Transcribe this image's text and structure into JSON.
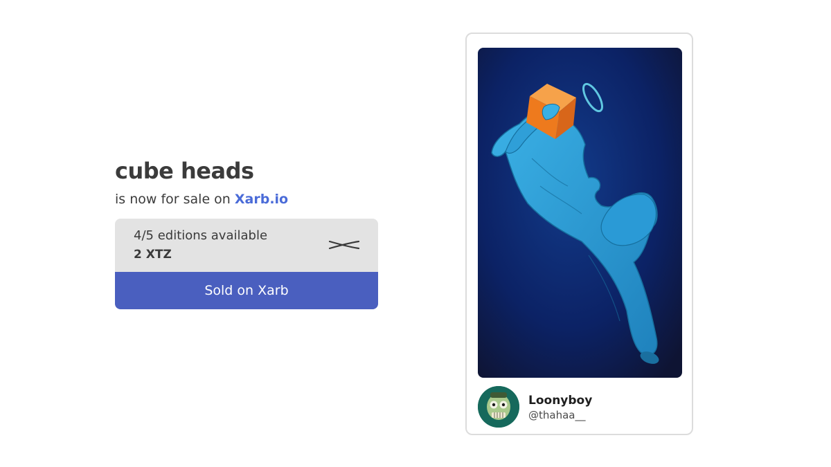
{
  "promo": {
    "title": "cube heads",
    "subtitle_prefix": "is now for sale on ",
    "marketplace": "Xarb.io"
  },
  "listing": {
    "editions": "4/5 editions available",
    "price": "2 XTZ",
    "logo_icon": "xarb-logo-icon",
    "button_label": "Sold on Xarb"
  },
  "card": {
    "artwork_icon": "artwork-image",
    "creator": {
      "name": "Loonyboy",
      "handle": "@thahaa__",
      "avatar_icon": "avatar-image"
    }
  },
  "colors": {
    "accent": "#4a5fbf",
    "link": "#4a6bd8",
    "info_background": "#e3e3e3",
    "artwork_background": "#0d1a4a",
    "figure": "#2b9ad0",
    "cube": "#f07b1e"
  }
}
